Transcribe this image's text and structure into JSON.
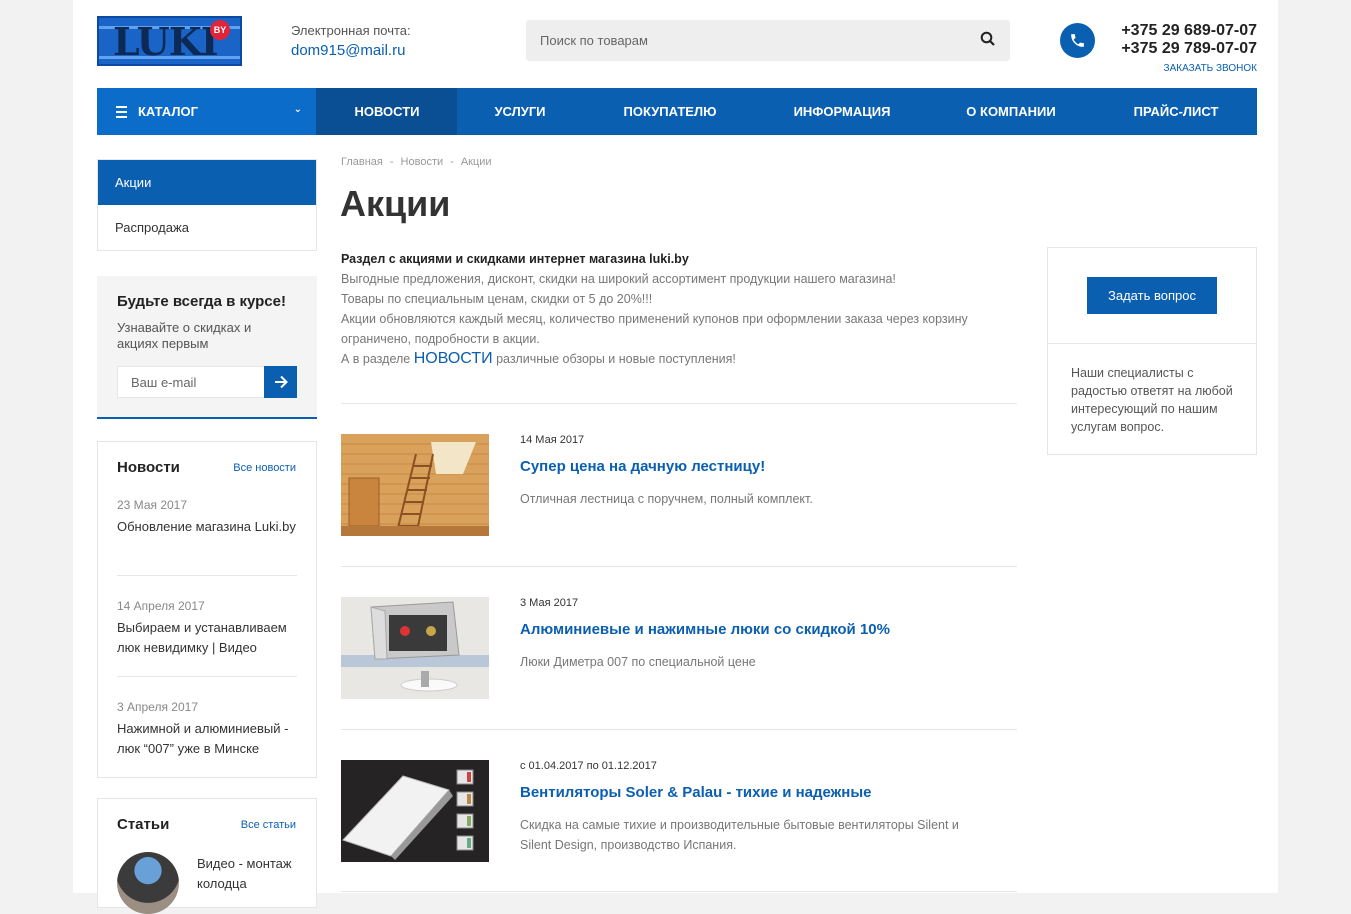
{
  "header": {
    "logo_text": "LUKI",
    "logo_badge": "BY",
    "email_label": "Электронная почта:",
    "email": "dom915@mail.ru",
    "search_placeholder": "Поиск по товарам",
    "phone1": "+375 29 689-07-07",
    "phone2": "+375 29 789-07-07",
    "callback": "ЗАКАЗАТЬ ЗВОНОК"
  },
  "nav": {
    "catalog": "КАТАЛОГ",
    "items": [
      "НОВОСТИ",
      "УСЛУГИ",
      "ПОКУПАТЕЛЮ",
      "ИНФОРМАЦИЯ",
      "О КОМПАНИИ",
      "ПРАЙС-ЛИСТ"
    ],
    "active": "НОВОСТИ"
  },
  "sidebar": {
    "menu": [
      "Акции",
      "Распродажа"
    ],
    "subscribe": {
      "title": "Будьте всегда в курсе!",
      "text": "Узнавайте о скидках и акциях первым",
      "placeholder": "Ваш e-mail"
    },
    "news": {
      "title": "Новости",
      "all_link": "Все новости",
      "items": [
        {
          "date": "23 Мая 2017",
          "title": "Обновление магазина Luki.by"
        },
        {
          "date": "14 Апреля 2017",
          "title": "Выбираем и устанавливаем люк невидимку | Видео"
        },
        {
          "date": "3 Апреля 2017",
          "title": "Нажимной и алюминиевый - люк “007” уже в Минске"
        }
      ]
    },
    "articles": {
      "title": "Статьи",
      "all_link": "Все статьи",
      "items": [
        {
          "title": "Видео - монтаж колодца"
        }
      ]
    }
  },
  "breadcrumbs": [
    "Главная",
    "Новости",
    "Акции"
  ],
  "page_title": "Акции",
  "intro": {
    "heading": "Раздел с акциями и скидками интернет магазина luki.by",
    "line1": "Выгодные предложения, дисконт, скидки на широкий ассортимент продукции нашего магазина!",
    "line2": "Товары по специальным ценам, скидки от 5 до 20%!!!",
    "line3": "Акции обновляются каждый месяц, количество применений купонов при оформлении заказа через корзину ограничено, подробности в акции.",
    "line4_prefix": "А в разделе ",
    "line4_link": "НОВОСТИ",
    "line4_suffix": " различные обзоры и новые поступления!"
  },
  "promos": [
    {
      "date": "14 Мая 2017",
      "title": "Супер цена на дачную лестницу!",
      "desc": "Отличная лестница с поручнем, полный комплект.",
      "image": "wooden-stairs"
    },
    {
      "date": "3 Мая 2017",
      "title": "Алюминиевые и нажимные люки со скидкой 10%",
      "desc": "Люки Диметра 007 по специальной цене",
      "image": "access-hatch"
    },
    {
      "date": "с 01.04.2017 по 01.12.2017",
      "title": "Вентиляторы Soler & Palau - тихие и надежные",
      "desc": "Скидка на самые тихие и производительные бытовые вентиляторы Silent и Silent Design, производство Испания.",
      "image": "fan"
    }
  ],
  "ask_widget": {
    "button": "Задать вопрос",
    "text": "Наши специалисты с радостью ответят на любой интересующий по нашим услугам вопрос."
  },
  "colors": {
    "accent": "#0b5fb0",
    "nav_active": "#0a4f93",
    "badge": "#e0243a"
  }
}
